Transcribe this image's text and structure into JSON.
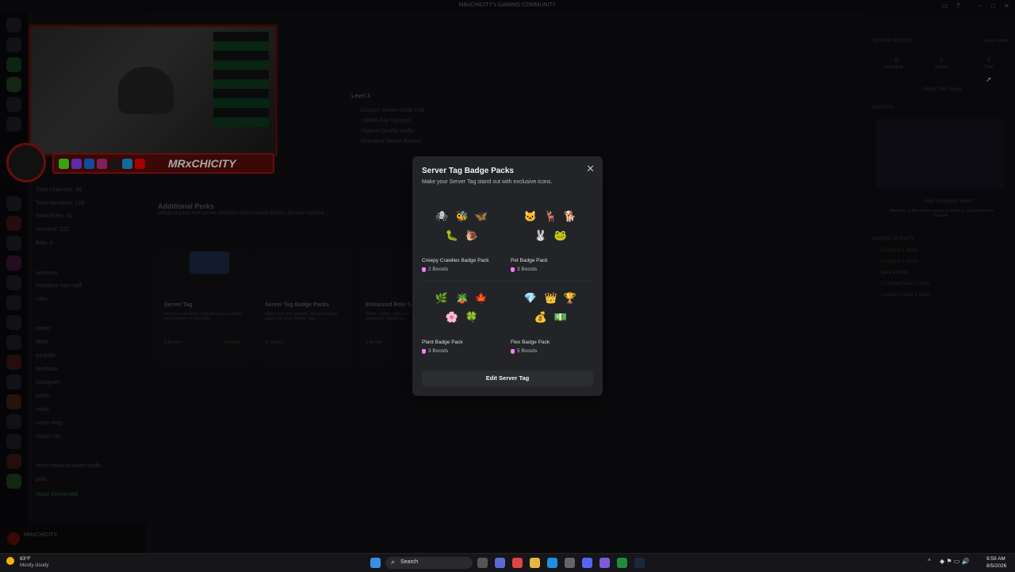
{
  "window": {
    "title": "MRxCHICITY's GAMING COMMUNITY"
  },
  "webcam": {
    "banner_text": "MRxCHICITY"
  },
  "sidebar": {
    "stats": [
      "Total Channels: 68",
      "Total Members: 129",
      "Total Roles: 31",
      "Humans: 125",
      "Bots: 4"
    ],
    "channels": [
      "welcome",
      "introduce-your-self",
      "rules",
      "twitter",
      "tiktok",
      "youtube",
      "facebook",
      "instagram",
      "twitch",
      "mobil",
      "carey-rings",
      "coach-city",
      "chim-cream-bracket-challe...",
      "pulls"
    ],
    "voice_status": "Voice Connected",
    "username": "MRxCHICITY"
  },
  "main": {
    "level3": "Level 3",
    "level3_perks": [
      "Custom Server Invite Link",
      "100MB File Uploads",
      "Highest Quality Audio",
      "Animated Server Banner"
    ],
    "additional_perks_title": "Additional Perks",
    "additional_perks_sub": "Individual perks that can be unlocked using available Boosts. No level required.",
    "perk_cards": [
      {
        "title": "Server Tag",
        "desc": "Let your members represent your server everywhere on Discord.",
        "cost": "3 Boosts",
        "status": "Enabled"
      },
      {
        "title": "Server Tag Badge Packs",
        "desc": "Stand out with special, themed badge packs for your Server Tag.",
        "cost": "2+ Boosts"
      },
      {
        "title": "Enhanced Role S...",
        "desc": "Make certain roles feel animated, vibrant gr...",
        "cost": "3 Boosts"
      }
    ]
  },
  "right_panel": {
    "boosts_title": "SERVER BOOSTS",
    "learn_more": "Learn More",
    "available": "0",
    "available_label": "Available",
    "spent": "5",
    "spent_label": "Spent",
    "total": "5",
    "total_label": "Total",
    "boost_button": "Boost This Server",
    "notices": "NOTICES",
    "how_title": "How do Boosts work?",
    "how_desc": "Members of this server can pay to Boost it, and unlock new features.",
    "recent_activity": "RECENT ACTIVITY",
    "activity": [
      "CHI gave 1 boost",
      "CHI gave 1 boost",
      "gave 1 boost",
      "Cuzzmee gave 1 boost",
      "Cramerhy gave 1 boost"
    ]
  },
  "modal": {
    "title": "Server Tag Badge Packs",
    "subtitle": "Make your Server Tag stand out with exclusive icons.",
    "packs": [
      {
        "name": "Creepy Crawlies Badge Pack",
        "cost": "2 Boosts",
        "icons": [
          "🕷",
          "🐝",
          "🦋",
          "🐛",
          "🐌"
        ]
      },
      {
        "name": "Pet Badge Pack",
        "cost": "3 Boosts",
        "icons": [
          "🐱",
          "🦌",
          "🐕",
          "🐰",
          "🐸"
        ]
      },
      {
        "name": "Plant Badge Pack",
        "cost": "3 Boosts",
        "icons": [
          "🌿",
          "🪴",
          "🍁",
          "🌸",
          "🍀"
        ]
      },
      {
        "name": "Flex Badge Pack",
        "cost": "5 Boosts",
        "icons": [
          "💎",
          "👑",
          "🏆",
          "💰",
          "💵"
        ]
      }
    ],
    "edit_button": "Edit Server Tag"
  },
  "taskbar": {
    "weather_temp": "83°F",
    "weather_desc": "Mostly cloudy",
    "search": "Search",
    "time": "9:59 AM",
    "date": "8/5/2026"
  }
}
